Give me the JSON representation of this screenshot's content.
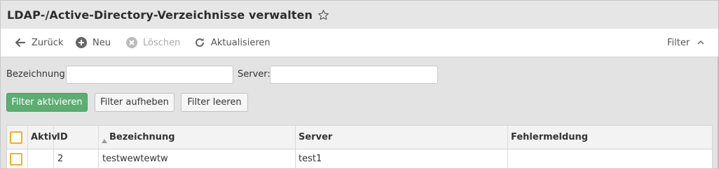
{
  "header": {
    "title": "LDAP-/Active-Directory-Verzeichnisse verwalten",
    "favorite_icon": "star-outline-icon"
  },
  "toolbar": {
    "back_label": "Zurück",
    "new_label": "Neu",
    "delete_label": "Löschen",
    "refresh_label": "Aktualisieren",
    "filter_label": "Filter"
  },
  "filter": {
    "bezeichnung_label": "Bezeichnung:",
    "bezeichnung_value": "",
    "server_label": "Server:",
    "server_value": "",
    "apply_label": "Filter aktivieren",
    "clear_label": "Filter aufheben",
    "empty_label": "Filter leeren"
  },
  "grid": {
    "columns": [
      "Aktiv",
      "ID",
      "Bezeichnung",
      "Server",
      "Fehlermeldung"
    ],
    "sort_column": "Bezeichnung",
    "rows": [
      {
        "aktiv": "",
        "id": "2",
        "bezeichnung": "testwewtewtw",
        "server": "test1",
        "fehlermeldung": ""
      }
    ]
  },
  "colors": {
    "accent_checkbox": "#f0b21e",
    "primary_button": "#5cad72"
  }
}
